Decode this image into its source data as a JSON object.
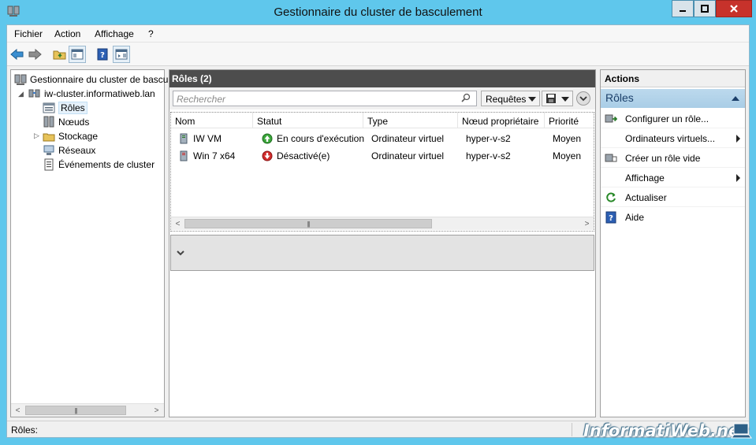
{
  "window": {
    "title": "Gestionnaire du cluster de basculement"
  },
  "menu": {
    "items": [
      "Fichier",
      "Action",
      "Affichage",
      "?"
    ]
  },
  "tree": {
    "root": "Gestionnaire du cluster de basculement",
    "cluster": "iw-cluster.informatiweb.lan",
    "children": [
      "Rôles",
      "Nœuds",
      "Stockage",
      "Réseaux",
      "Événements de cluster"
    ]
  },
  "center": {
    "header": "Rôles (2)",
    "search_placeholder": "Rechercher",
    "queries_label": "Requêtes",
    "columns": [
      "Nom",
      "Statut",
      "Type",
      "Nœud propriétaire",
      "Priorité"
    ],
    "rows": [
      {
        "name": "IW VM",
        "status": "En cours d'exécution",
        "type": "Ordinateur virtuel",
        "owner": "hyper-v-s2",
        "priority": "Moyen"
      },
      {
        "name": "Win 7 x64",
        "status": "Désactivé(e)",
        "type": "Ordinateur virtuel",
        "owner": "hyper-v-s2",
        "priority": "Moyen"
      }
    ]
  },
  "actions": {
    "header": "Actions",
    "group": "Rôles",
    "items": [
      {
        "label": "Configurer un rôle...",
        "icon": "configure-role-icon"
      },
      {
        "label": "Ordinateurs virtuels...",
        "icon": ""
      },
      {
        "label": "Créer un rôle vide",
        "icon": "create-role-icon"
      },
      {
        "label": "Affichage",
        "icon": ""
      },
      {
        "label": "Actualiser",
        "icon": "refresh-icon"
      },
      {
        "label": "Aide",
        "icon": "help-icon"
      }
    ]
  },
  "status": {
    "text": "Rôles:"
  },
  "watermark": "InformatiWeb.net",
  "colors": {
    "titlebar": "#5fc7ec",
    "running": "#3aa53a",
    "stopped": "#d12b2b",
    "pane_header": "#4d4d4d",
    "actions_group": "#bcd9ed"
  }
}
